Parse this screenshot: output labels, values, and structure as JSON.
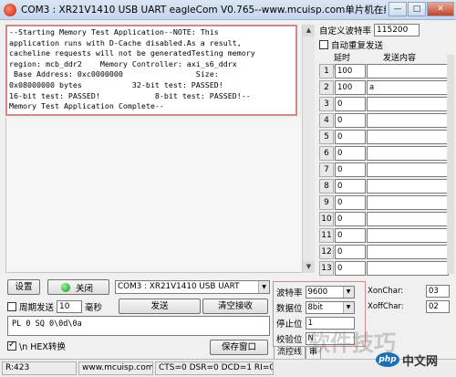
{
  "window": {
    "title": "COM3 : XR21V1410 USB UART   eagleCom V0.765--www.mcuisp.com单片机在线编...",
    "min_glyph": "—",
    "max_glyph": "□",
    "close_glyph": "✕"
  },
  "receive": {
    "lines": [
      "--Starting Memory Test Application--NOTE: This",
      "application runs with D-Cache disabled.As a result,",
      "cacheline requests will not be generatedTesting memory",
      "region: mcb_ddr2    Memory Controller: axi_s6_ddrx",
      " Base Address: 0xc0000000                Size:",
      "0x08000000 bytes           32-bit test: PASSED!",
      "16-bit test: PASSED!            8-bit test: PASSED!--",
      "Memory Test Application Complete--"
    ]
  },
  "multi_send": {
    "custom_baud_label": "自定义波特率",
    "custom_baud_value": "115200",
    "auto_repeat_label": "自动重复发送",
    "delay_header": "延时 ms",
    "content_header": "发送内容",
    "rows": [
      {
        "num": "1",
        "delay": "100",
        "content": ""
      },
      {
        "num": "2",
        "delay": "100",
        "content": "a"
      },
      {
        "num": "3",
        "delay": "0",
        "content": ""
      },
      {
        "num": "4",
        "delay": "0",
        "content": ""
      },
      {
        "num": "5",
        "delay": "0",
        "content": ""
      },
      {
        "num": "6",
        "delay": "0",
        "content": ""
      },
      {
        "num": "7",
        "delay": "0",
        "content": ""
      },
      {
        "num": "8",
        "delay": "0",
        "content": ""
      },
      {
        "num": "9",
        "delay": "0",
        "content": ""
      },
      {
        "num": "10",
        "delay": "0",
        "content": ""
      },
      {
        "num": "11",
        "delay": "0",
        "content": ""
      },
      {
        "num": "12",
        "delay": "0",
        "content": ""
      },
      {
        "num": "13",
        "delay": "0",
        "content": ""
      }
    ]
  },
  "controls": {
    "settings_label": "设置",
    "close_label": "关闭",
    "port_value": "COM3 : XR21V1410 USB UART",
    "period_send_label": "周期发送",
    "period_value": "10",
    "period_unit": "毫秒",
    "send_label": "发送",
    "clear_recv_label": "清空接收",
    "send_text": "PL 0 SQ 0\\0d\\0a",
    "hex_label": "\\n HEX转换",
    "save_window_label": "保存窗口"
  },
  "serial": {
    "baud_label": "波特率",
    "baud_value": "9600",
    "data_bits_label": "数据位",
    "data_bits_value": "8bit",
    "stop_bits_label": "停止位",
    "stop_bits_value": "1",
    "parity_label": "校验位",
    "parity_value": "N",
    "xon_label": "XonChar:",
    "xon_value": "03",
    "xoff_label": "XoffChar:",
    "xoff_value": "02",
    "tab_flow": "流控线",
    "tab_other": "串"
  },
  "status": {
    "rx": "R:423",
    "site": "www.mcuisp.com",
    "lines": "CTS=0 DSR=0 DCD=1 RI=0"
  },
  "watermark": {
    "text": "软件技巧",
    "logo_php": "php",
    "logo_cn": "中文网"
  }
}
